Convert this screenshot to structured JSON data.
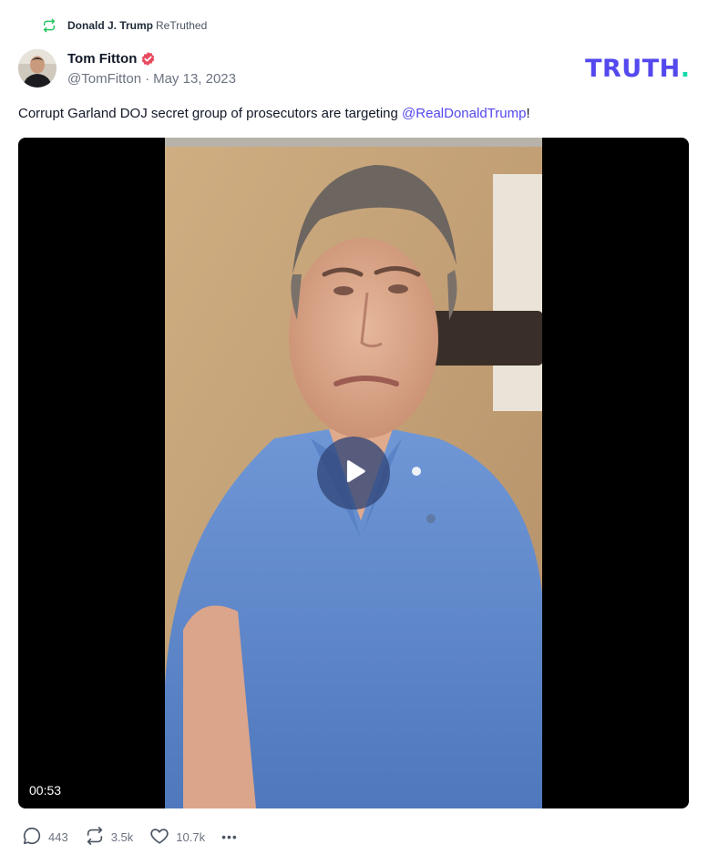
{
  "retruth": {
    "icon": "retruth-icon",
    "user": "Donald J. Trump",
    "label": "ReTruthed"
  },
  "author": {
    "display_name": "Tom Fitton",
    "verified_icon": "verified-badge-icon",
    "handle": "@TomFitton",
    "separator": "·",
    "date": "May 13, 2023"
  },
  "brand": {
    "wordmark": "TRUTH",
    "dot": ".",
    "primary_color": "#5448ee",
    "dot_color": "#16d9a9"
  },
  "post": {
    "text": "Corrupt Garland DOJ secret group of prosecutors are targeting ",
    "mention": "@RealDonaldTrump",
    "text_end": "!"
  },
  "video": {
    "duration": "00:53",
    "play_icon": "play-icon"
  },
  "actions": {
    "replies": {
      "icon": "reply-icon",
      "count": "443"
    },
    "retruths": {
      "icon": "retruth-icon",
      "count": "3.5k"
    },
    "likes": {
      "icon": "heart-icon",
      "count": "10.7k"
    },
    "more": {
      "icon": "more-icon",
      "label": "•••"
    }
  }
}
